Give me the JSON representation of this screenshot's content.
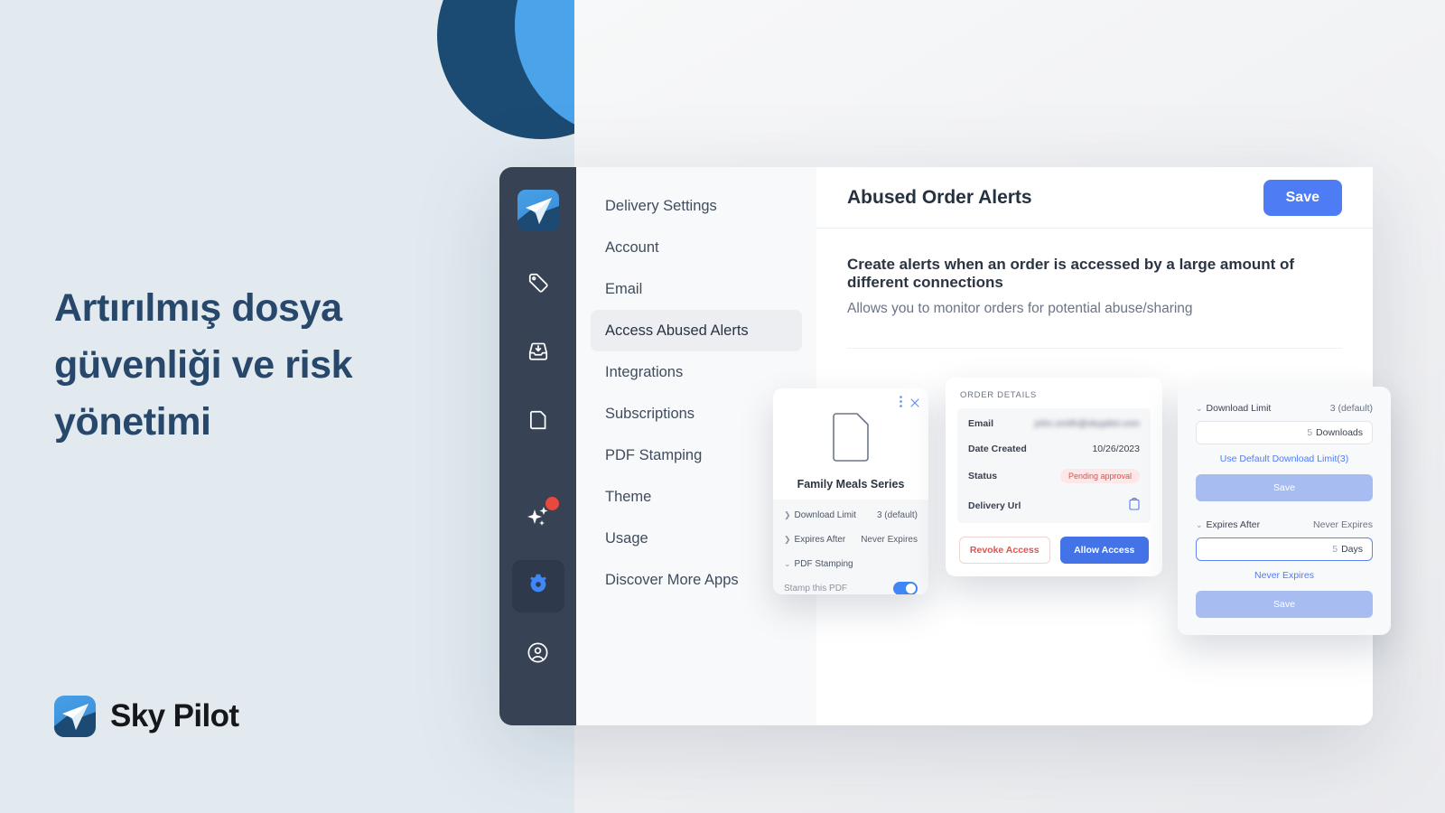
{
  "marketing": {
    "headline": "Artırılmış dosya güvenliği ve risk yönetimi",
    "brand_name": "Sky Pilot"
  },
  "colors": {
    "page_background": "#e2eaf0",
    "circle_navy": "#1b4a72",
    "circle_blue": "#4ba3ea",
    "headline_color": "#27486b",
    "rail_background": "#374355",
    "accent_blue": "#4e7cf5",
    "muted_blue": "#a7bdf2",
    "danger_red": "#e2524c",
    "badge_red_bg": "#fde7e7",
    "notification_dot": "#e8483f"
  },
  "rail": {
    "logo_name": "sky-pilot-logo",
    "items": [
      {
        "icon": "tag-icon",
        "active": false,
        "badge": false
      },
      {
        "icon": "inbox-download-icon",
        "active": false,
        "badge": false
      },
      {
        "icon": "document-icon",
        "active": false,
        "badge": false
      },
      {
        "icon": "sparkles-icon",
        "active": false,
        "badge": true
      },
      {
        "icon": "gear-icon",
        "active": true,
        "badge": false
      },
      {
        "icon": "account-circle-icon",
        "active": false,
        "badge": false
      }
    ]
  },
  "settings_nav": {
    "items": [
      {
        "label": "Delivery Settings",
        "active": false
      },
      {
        "label": "Account",
        "active": false
      },
      {
        "label": "Email",
        "active": false
      },
      {
        "label": "Access Abused Alerts",
        "active": true
      },
      {
        "label": "Integrations",
        "active": false
      },
      {
        "label": "Subscriptions",
        "active": false
      },
      {
        "label": "PDF Stamping",
        "active": false
      },
      {
        "label": "Theme",
        "active": false
      },
      {
        "label": "Usage",
        "active": false
      },
      {
        "label": "Discover More Apps",
        "active": false
      }
    ]
  },
  "content": {
    "title": "Abused Order Alerts",
    "save_label": "Save",
    "body_title": "Create alerts when an order is accessed by a large amount of different connections",
    "body_subtitle": "Allows you to monitor orders for potential abuse/sharing"
  },
  "product_card": {
    "menu_icon": "vertical-dots-icon",
    "close_icon": "close-icon",
    "doc_icon": "document-icon",
    "product_name": "Family Meals Series",
    "rows": [
      {
        "label": "Download Limit",
        "value": "3 (default)",
        "chevron": "chevron-right-icon"
      },
      {
        "label": "Expires After",
        "value": "Never Expires",
        "chevron": "chevron-right-icon"
      }
    ],
    "section_label": "PDF Stamping",
    "section_chevron": "chevron-down-icon",
    "toggle_label": "Stamp this PDF",
    "toggle_on": true
  },
  "order_card": {
    "title": "ORDER DETAILS",
    "rows": [
      {
        "label": "Email",
        "value": "john.smith@skypilot.com",
        "type": "blurred"
      },
      {
        "label": "Date Created",
        "value": "10/26/2023",
        "type": "text"
      },
      {
        "label": "Status",
        "value": "Pending approval",
        "type": "badge"
      },
      {
        "label": "Delivery Url",
        "value": "copy-clipboard-icon",
        "type": "icon"
      }
    ],
    "revoke_label": "Revoke Access",
    "allow_label": "Allow Access"
  },
  "limits_card": {
    "download_limit": {
      "label": "Download Limit",
      "value": "3 (default)",
      "chevron": "chevron-down-icon",
      "input_number": "5",
      "input_unit": "Downloads",
      "link": "Use Default Download Limit(3)",
      "save_label": "Save"
    },
    "expires_after": {
      "label": "Expires After",
      "value": "Never Expires",
      "chevron": "chevron-down-icon",
      "input_number": "5",
      "input_unit": "Days",
      "input_focused": true,
      "link": "Never Expires",
      "save_label": "Save"
    }
  }
}
